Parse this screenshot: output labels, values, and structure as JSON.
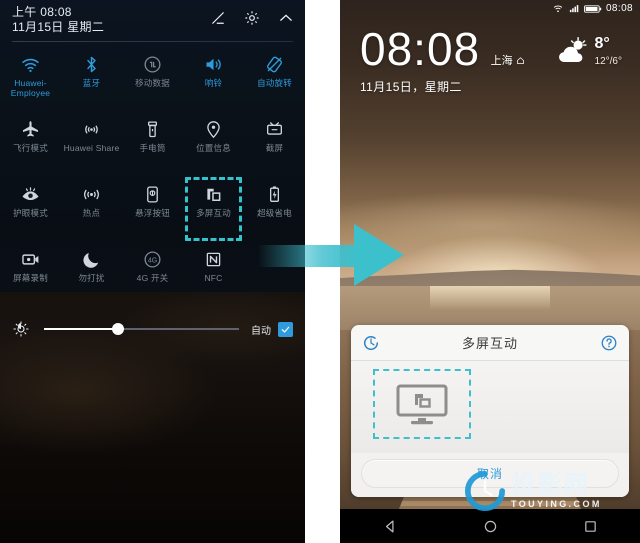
{
  "left_panel": {
    "status": {
      "time": "上午 08:08",
      "date": "11月15日 星期二"
    },
    "header_icons": [
      {
        "name": "edit-icon",
        "label": "编辑"
      },
      {
        "name": "settings-gear-icon",
        "label": "设置"
      },
      {
        "name": "chevron-up-icon",
        "label": "收起"
      }
    ],
    "tiles": [
      {
        "label": "Huawei-Employee",
        "icon": "wifi-icon",
        "state": "on"
      },
      {
        "label": "蓝牙",
        "icon": "bluetooth-icon",
        "state": "on"
      },
      {
        "label": "移动数据",
        "icon": "mobile-data-icon",
        "state": "off"
      },
      {
        "label": "响铃",
        "icon": "ringer-icon",
        "state": "on"
      },
      {
        "label": "自动旋转",
        "icon": "auto-rotate-icon",
        "state": "on"
      },
      {
        "label": "飞行模式",
        "icon": "airplane-icon",
        "state": "off"
      },
      {
        "label": "Huawei Share",
        "icon": "huawei-share-icon",
        "state": "off"
      },
      {
        "label": "手电筒",
        "icon": "flashlight-icon",
        "state": "off"
      },
      {
        "label": "位置信息",
        "icon": "location-pin-icon",
        "state": "off"
      },
      {
        "label": "截屏",
        "icon": "screenshot-icon",
        "state": "off"
      },
      {
        "label": "护眼模式",
        "icon": "eye-comfort-icon",
        "state": "off"
      },
      {
        "label": "热点",
        "icon": "hotspot-icon",
        "state": "off"
      },
      {
        "label": "悬浮按钮",
        "icon": "floating-dock-icon",
        "state": "off"
      },
      {
        "label": "多屏互动",
        "icon": "mirrorshare-icon",
        "state": "off",
        "selected": true
      },
      {
        "label": "超级省电",
        "icon": "battery-saver-icon",
        "state": "off"
      },
      {
        "label": "屏幕录制",
        "icon": "screen-record-icon",
        "state": "off"
      },
      {
        "label": "勿打扰",
        "icon": "do-not-disturb-icon",
        "state": "off"
      },
      {
        "label": "4G 开关",
        "icon": "four-g-icon",
        "state": "off"
      },
      {
        "label": "NFC",
        "icon": "nfc-icon",
        "state": "off"
      }
    ],
    "brightness": {
      "icon": "brightness-sun-icon",
      "value_percent": 38,
      "auto_label": "自动",
      "auto_checked": true
    }
  },
  "arrow": {
    "name": "flow-arrow",
    "direction": "right",
    "color": "#3cc0cc"
  },
  "right_panel": {
    "status": {
      "time": "08:08",
      "icons": [
        "wifi-icon",
        "signal-icon",
        "battery-icon"
      ]
    },
    "lockscreen": {
      "time": "08:08",
      "city": "上海",
      "date": "11月15日，星期二",
      "weather": {
        "icon": "partly-cloudy-icon",
        "temperature": "8°",
        "range": "12°/6°"
      }
    },
    "dialog": {
      "title": "多屏互动",
      "refresh_icon": "refresh-scan-icon",
      "help_icon": "help-question-icon",
      "device_slot": {
        "icon": "monitor-cast-icon",
        "empty": true
      },
      "cancel_label": "取消"
    },
    "watermark": {
      "cn": "投影网",
      "en": "TOUYING.COM",
      "icon": "ring-logo-icon"
    },
    "navbar": [
      {
        "name": "nav-back-icon",
        "label": "返回"
      },
      {
        "name": "nav-home-icon",
        "label": "主页"
      },
      {
        "name": "nav-recents-icon",
        "label": "最近任务"
      }
    ]
  },
  "colors": {
    "accent_blue": "#2f9bdc",
    "highlight_cyan": "#3cc0cc",
    "inactive_gray": "#7d8893"
  }
}
